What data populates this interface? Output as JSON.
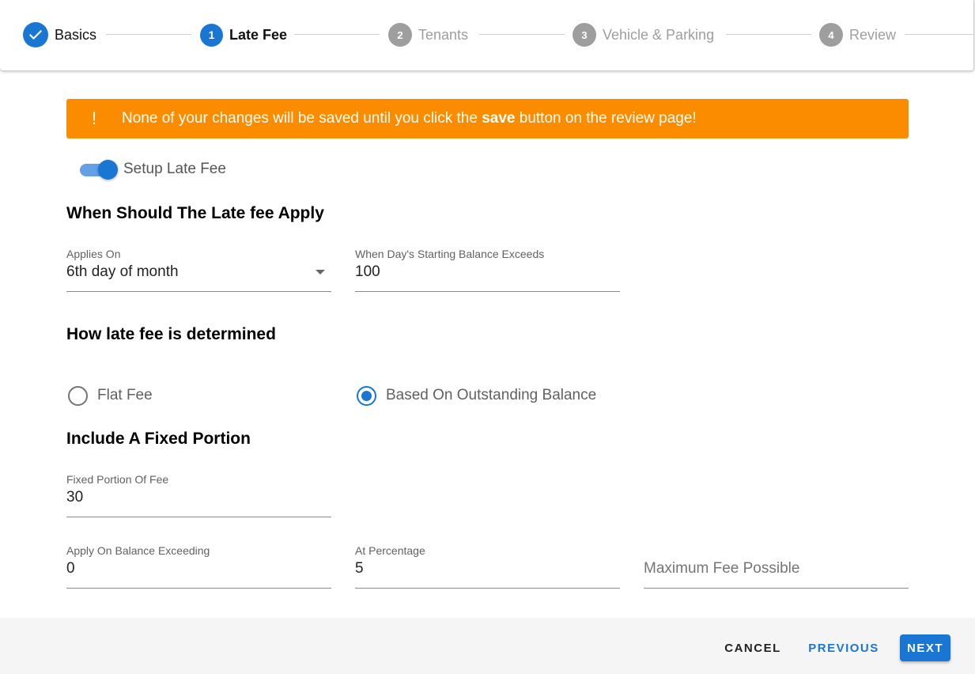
{
  "stepper": {
    "steps": [
      {
        "number": "",
        "label": "Basics",
        "state": "completed",
        "icon": "check-icon"
      },
      {
        "number": "1",
        "label": "Late Fee",
        "state": "active"
      },
      {
        "number": "2",
        "label": "Tenants",
        "state": "pending"
      },
      {
        "number": "3",
        "label": "Vehicle & Parking",
        "state": "pending"
      },
      {
        "number": "4",
        "label": "Review",
        "state": "pending"
      }
    ]
  },
  "banner": {
    "icon": "!",
    "text_before": "None of your changes will be saved until you click the ",
    "text_bold": "save",
    "text_after": " button on the review page!",
    "color": "#fb8c00"
  },
  "toggle": {
    "label": "Setup Late Fee",
    "checked": true
  },
  "sections": {
    "apply": "When Should The Late fee Apply",
    "determined": "How late fee is determined",
    "fixed": "Include A Fixed Portion"
  },
  "fields": {
    "applies_on": {
      "label": "Applies On",
      "value": "6th day of month"
    },
    "balance_exceeds": {
      "label": "When Day's Starting Balance Exceeds",
      "value": "100"
    },
    "fixed_portion": {
      "label": "Fixed Portion Of Fee",
      "value": "30"
    },
    "apply_on_balance": {
      "label": "Apply On Balance Exceeding",
      "value": "0"
    },
    "at_percentage": {
      "label": "At Percentage",
      "value": "5"
    },
    "max_fee": {
      "placeholder": "Maximum Fee Possible",
      "value": ""
    }
  },
  "radios": {
    "flat_fee": {
      "label": "Flat Fee",
      "checked": false
    },
    "outstanding": {
      "label": "Based On Outstanding Balance",
      "checked": true
    }
  },
  "footer": {
    "cancel": "CANCEL",
    "previous": "PREVIOUS",
    "next": "NEXT"
  },
  "colors": {
    "primary": "#1976d2",
    "pending": "#9e9e9e",
    "warning": "#fb8c00"
  }
}
